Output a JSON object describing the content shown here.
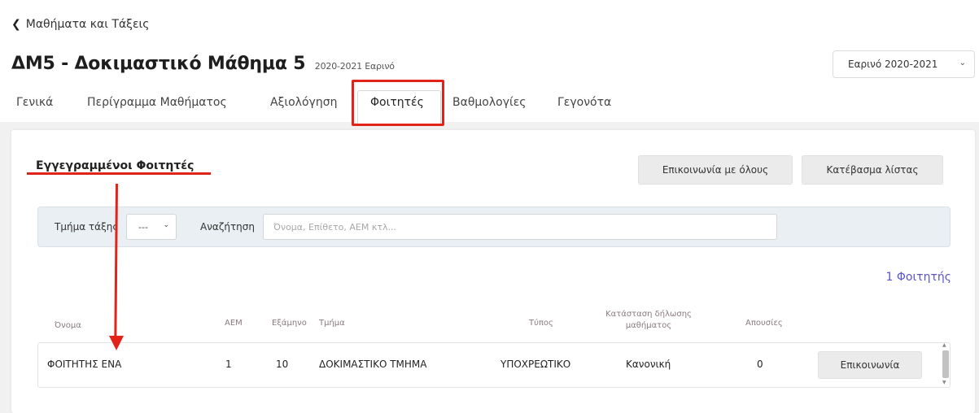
{
  "header": {
    "back_label": "Μαθήματα και Τάξεις",
    "course_title": "ΔΜ5 - Δοκιμαστικό Μάθημα 5",
    "course_subtitle": "2020-2021 Εαρινό",
    "semester_select_value": "Εαρινό 2020-2021"
  },
  "tabs": [
    {
      "label": "Γενικά"
    },
    {
      "label": "Περίγραμμα Μαθήματος"
    },
    {
      "label": "Αξιολόγηση"
    },
    {
      "label": "Φοιτητές",
      "active": true
    },
    {
      "label": "Βαθμολογίες"
    },
    {
      "label": "Γεγονότα"
    }
  ],
  "students_section": {
    "title": "Εγγεγραμμένοι Φοιτητές",
    "contact_all_label": "Επικοινωνία με όλους",
    "download_list_label": "Κατέβασμα λίστας",
    "filter": {
      "section_label": "Τμήμα τάξης",
      "section_value": "---",
      "search_label": "Αναζήτηση",
      "search_placeholder": "Όνομα, Επίθετο, ΑΕΜ κτλ..."
    },
    "count_label": "1 Φοιτητής",
    "columns": {
      "name": "Όνομα",
      "aem": "ΑΕΜ",
      "semester": "Εξάμηνο",
      "section": "Τμήμα",
      "type": "Τύπος",
      "status": "Κατάσταση δήλωσης μαθήματος",
      "absences": "Απουσίες"
    },
    "rows": [
      {
        "name": "ΦΟΙΤΗΤΗΣ ΕΝΑ",
        "aem": "1",
        "semester": "10",
        "section": "ΔΟΚΙΜΑΣΤΙΚΟ ΤΜΗΜΑ",
        "type": "ΥΠΟΧΡΕΩΤΙΚΟ",
        "status": "Κανονική",
        "absences": "0",
        "contact_label": "Επικοινωνία"
      }
    ]
  },
  "colors": {
    "annotation_red": "#e2231a",
    "count_link": "#5a55c8",
    "filter_bg": "#e9eff3"
  }
}
